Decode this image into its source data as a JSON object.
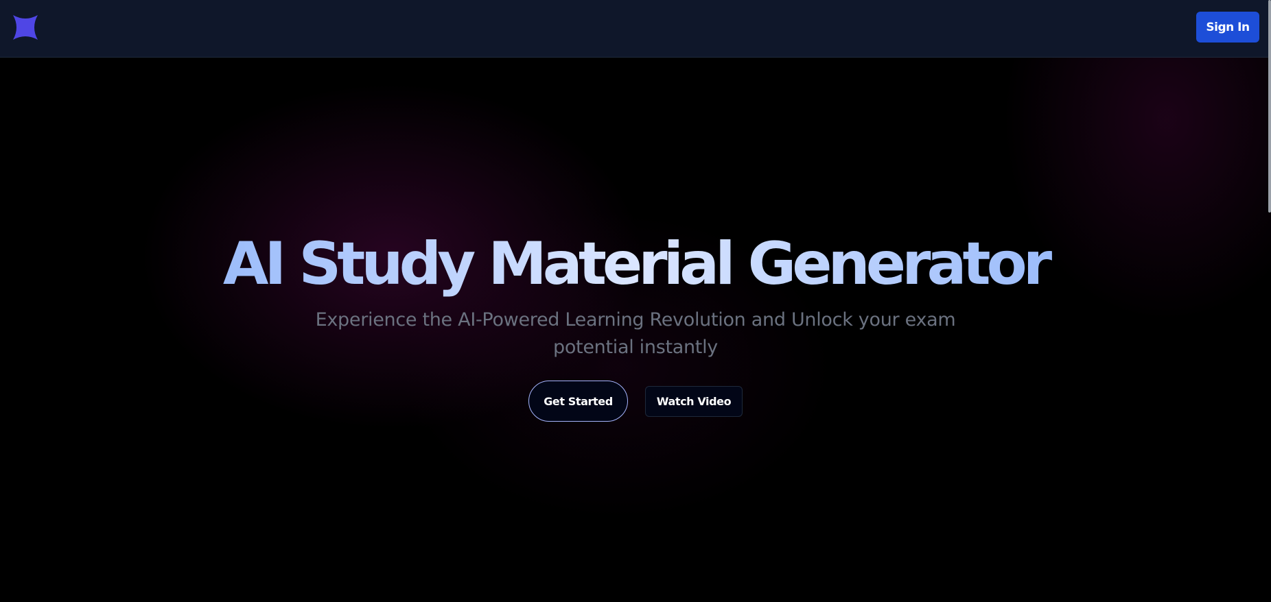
{
  "navbar": {
    "logo_icon": "four-point-star-icon",
    "logo_color": "#4f46e5",
    "signin_label": "Sign In"
  },
  "hero": {
    "title": "AI Study Material Generator",
    "subtitle": "Experience the AI-Powered Learning Revolution and Unlock your exam potential instantly",
    "get_started_label": "Get Started",
    "watch_video_label": "Watch Video"
  },
  "colors": {
    "navbar_bg": "#0f172a",
    "page_bg": "#000000",
    "primary_button": "#1d4ed8",
    "title_gradient_start": "#7aa6f8",
    "title_gradient_mid": "#dbe6ff",
    "subtitle_text": "#6b7280"
  }
}
